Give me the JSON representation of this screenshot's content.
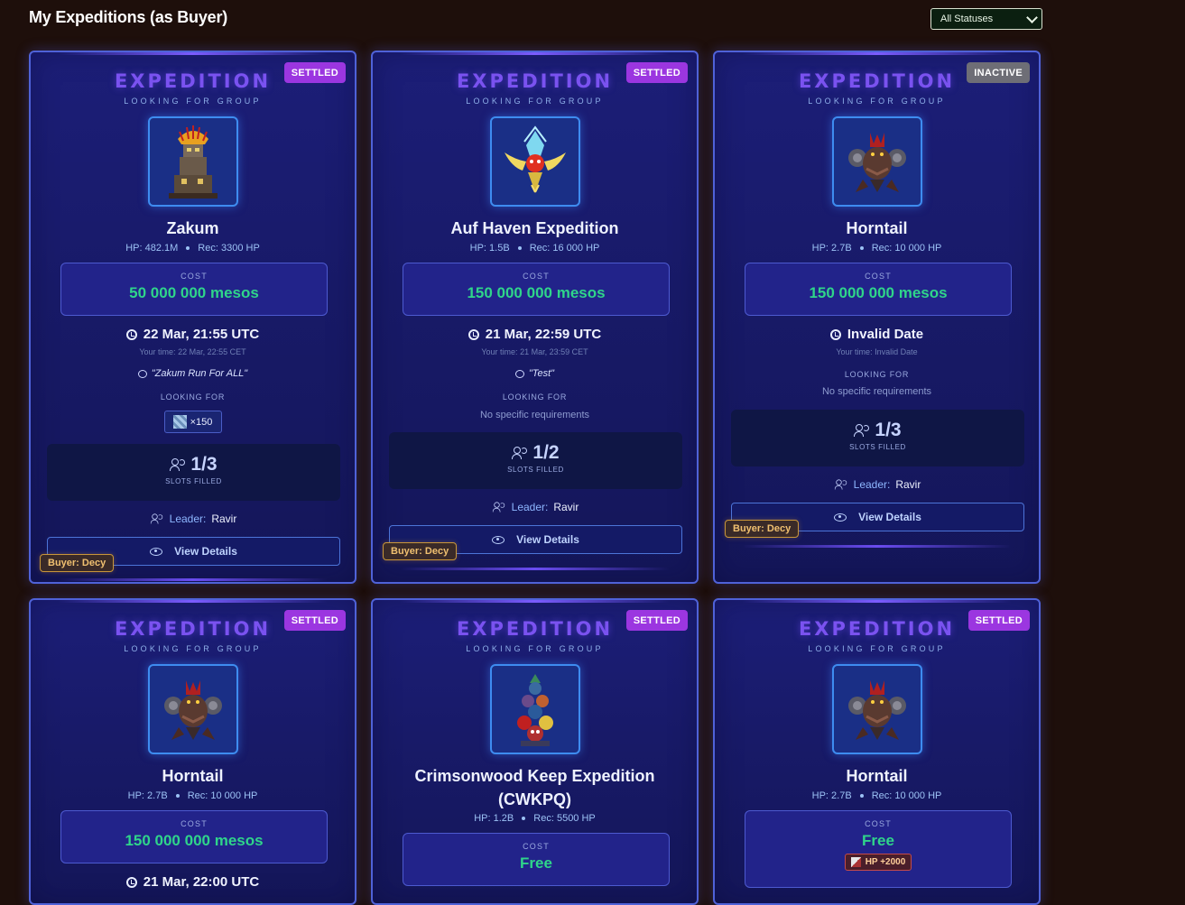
{
  "page": {
    "title": "My Expeditions (as Buyer)"
  },
  "filter": {
    "selected": "All Statuses"
  },
  "common": {
    "exp_title": "EXPEDITION",
    "exp_sub": "LOOKING FOR GROUP",
    "cost_label": "COST",
    "looking_for_label": "LOOKING FOR",
    "slots_label": "SLOTS FILLED",
    "leader_label": "Leader:",
    "view_details": "View Details",
    "hp_prefix": "HP:",
    "rec_prefix": "Rec:",
    "your_time_prefix": "Your time:"
  },
  "cards": [
    {
      "status": "SETTLED",
      "boss": "Zakum",
      "hp": "482.1M",
      "rec": "3300 HP",
      "cost": "50 000 000 mesos",
      "time": "22 Mar, 21:55 UTC",
      "your_time": "22 Mar, 22:55 CET",
      "note": "\"Zakum Run For ALL\"",
      "looking_for": "×150",
      "slots": "1/3",
      "leader": "Ravir",
      "buyer": "Buyer: Decy"
    },
    {
      "status": "SETTLED",
      "boss": "Auf Haven Expedition",
      "hp": "1.5B",
      "rec": "16 000 HP",
      "cost": "150 000 000 mesos",
      "time": "21 Mar, 22:59 UTC",
      "your_time": "21 Mar, 23:59 CET",
      "note": "\"Test\"",
      "looking_for": "No specific requirements",
      "slots": "1/2",
      "leader": "Ravir",
      "buyer": "Buyer: Decy"
    },
    {
      "status": "INACTIVE",
      "boss": "Horntail",
      "hp": "2.7B",
      "rec": "10 000 HP",
      "cost": "150 000 000 mesos",
      "time": "Invalid Date",
      "your_time": "Invalid Date",
      "looking_for": "No specific requirements",
      "slots": "1/3",
      "leader": "Ravir",
      "buyer": "Buyer: Decy"
    },
    {
      "status": "SETTLED",
      "boss": "Horntail",
      "hp": "2.7B",
      "rec": "10 000 HP",
      "cost": "150 000 000 mesos",
      "time": "21 Mar, 22:00 UTC"
    },
    {
      "status": "SETTLED",
      "boss_line1": "Crimsonwood Keep Expedition",
      "boss_line2": "(CWKPQ)",
      "hp": "1.2B",
      "rec": "5500 HP",
      "cost": "Free"
    },
    {
      "status": "SETTLED",
      "boss": "Horntail",
      "hp": "2.7B",
      "rec": "10 000 HP",
      "cost": "Free",
      "cost_extra": "HP +2000"
    }
  ],
  "colors": {
    "page_bg": "#1e0f0b",
    "card_bg": "#1c1e78",
    "accent_purple": "#7a52f0",
    "cost_green": "#2fd58a",
    "badge_settled": "#9b36e0",
    "badge_inactive": "#6e6e76",
    "buyer_gold": "#f0c070"
  },
  "icons": {
    "clock": "clock-icon",
    "note": "chat-bubble-icon",
    "slots": "users-icon",
    "leader": "users-icon",
    "details": "eye-icon",
    "filter": "chevron-down-icon"
  }
}
